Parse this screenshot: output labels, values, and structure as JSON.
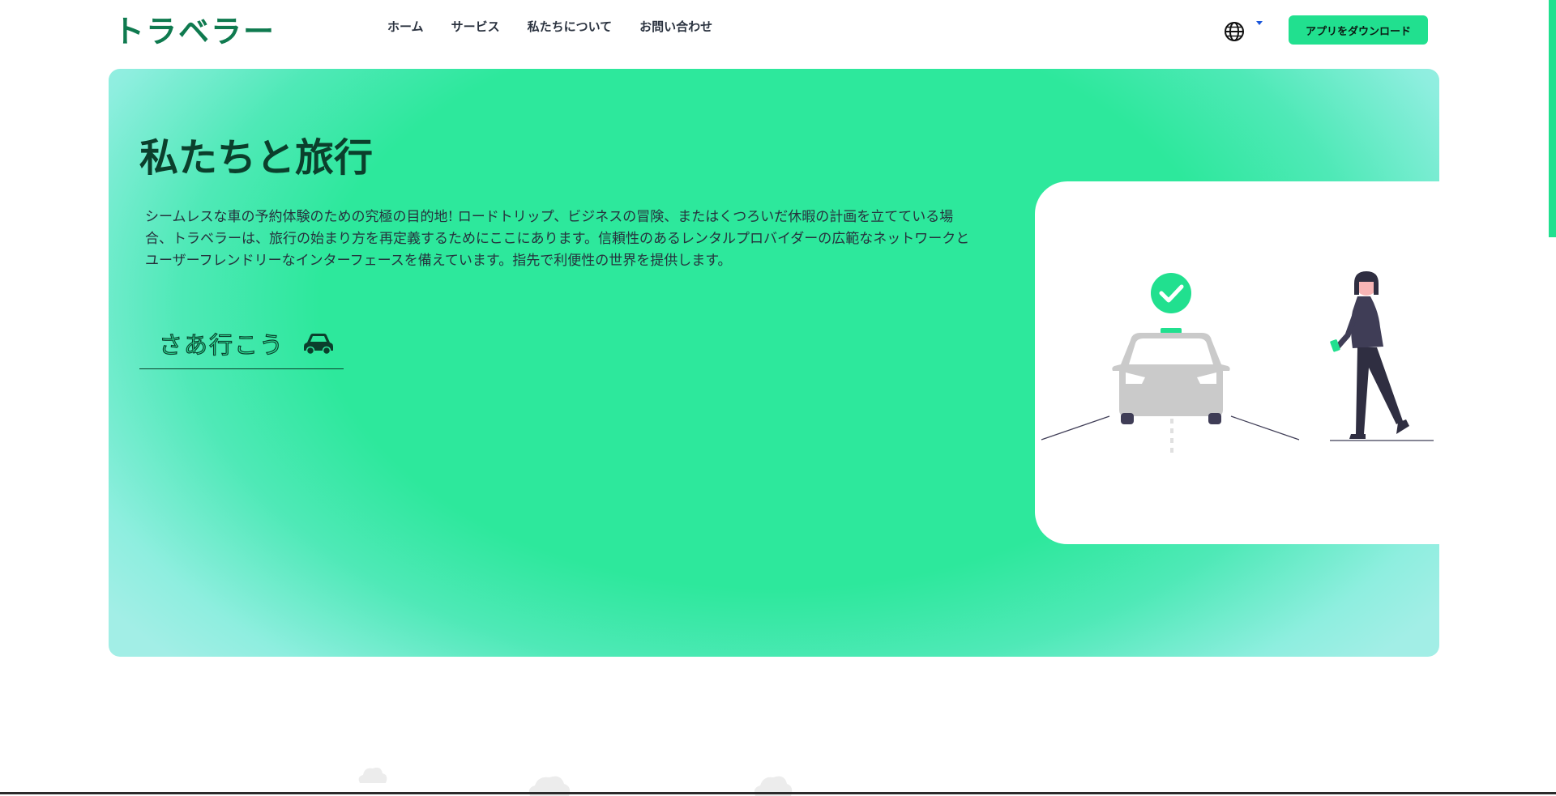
{
  "brand": {
    "logo_text": "トラベラー"
  },
  "nav": {
    "links": [
      {
        "label": "ホーム"
      },
      {
        "label": "サービス"
      },
      {
        "label": "私たちについて"
      },
      {
        "label": "お問い合わせ"
      }
    ],
    "language_icon": "globe-icon",
    "download_label": "アプリをダウンロード"
  },
  "hero": {
    "title": "私たちと旅行",
    "description": "シームレスな車の予約体験のための究極の目的地! ロードトリップ、ビジネスの冒険、またはくつろいだ休暇の計画を立てている場合、トラベラーは、旅行の始まり方を再定義するためにここにあります。信頼性のあるレンタルプロバイダーの広範なネットワークとユーザーフレンドリーなインターフェースを備えています。指先で利便性の世界を提供します。",
    "cta_label": "さあ行こう",
    "cta_icon": "car-icon",
    "illustration": "taxi-booking-illustration"
  },
  "colors": {
    "accent": "#21e08f",
    "hero_green": "#2de89c",
    "hero_edge": "#a2eee6",
    "dark_green": "#0b3f2c",
    "logo": "#0f7a4f"
  }
}
